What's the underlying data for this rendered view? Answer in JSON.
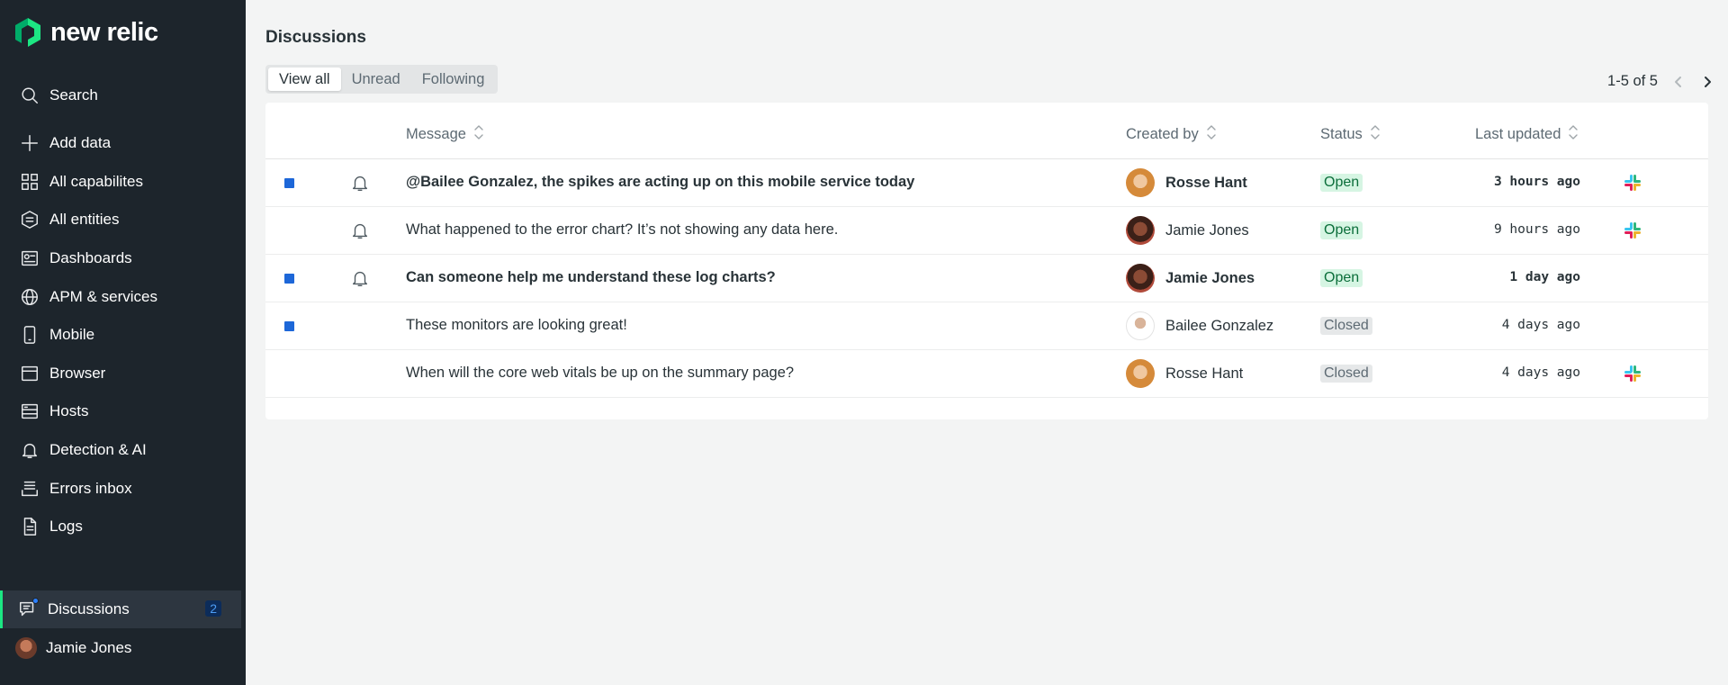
{
  "app": {
    "logo_text": "new relic",
    "brand_colors": {
      "primary": "#1ce783",
      "sidebar_bg": "#1d252c",
      "accent_blue": "#1d67d8"
    }
  },
  "sidebar": {
    "search_label": "Search",
    "items": [
      {
        "label": "Add data",
        "icon": "plus-icon"
      },
      {
        "label": "All capabilites",
        "icon": "grid-icon"
      },
      {
        "label": "All entities",
        "icon": "hexagon-icon"
      },
      {
        "label": "Dashboards",
        "icon": "dashboard-icon"
      },
      {
        "label": "APM & services",
        "icon": "globe-icon"
      },
      {
        "label": "Mobile",
        "icon": "mobile-icon"
      },
      {
        "label": "Browser",
        "icon": "browser-icon"
      },
      {
        "label": "Hosts",
        "icon": "server-icon"
      },
      {
        "label": "Detection & AI",
        "icon": "bell-icon"
      },
      {
        "label": "Errors inbox",
        "icon": "inbox-icon"
      },
      {
        "label": "Logs",
        "icon": "document-icon"
      }
    ],
    "discussions": {
      "label": "Discussions",
      "count": "2",
      "icon": "chat-icon"
    },
    "user": {
      "name": "Jamie Jones"
    }
  },
  "main": {
    "title": "Discussions",
    "tabs": [
      "View all",
      "Unread",
      "Following"
    ],
    "active_tab": "View all",
    "pagination": "1-5 of 5",
    "columns": {
      "message": "Message",
      "created_by": "Created by",
      "status": "Status",
      "last_updated": "Last updated"
    },
    "rows": [
      {
        "unread": true,
        "following": true,
        "message": "@Bailee Gonzalez, the spikes are acting up on this mobile service today",
        "creator": "Rosse Hant",
        "status": "Open",
        "updated": "3 hours ago",
        "slack": true
      },
      {
        "unread": false,
        "following": true,
        "message": "What happened to the error chart? It’s not showing any data here.",
        "creator": "Jamie Jones",
        "status": "Open",
        "updated": "9 hours ago",
        "slack": true
      },
      {
        "unread": true,
        "following": true,
        "message": "Can someone help me understand these log charts?",
        "creator": "Jamie Jones",
        "status": "Open",
        "updated": "1 day ago",
        "slack": false
      },
      {
        "unread": true,
        "following": false,
        "message": "These monitors are looking great!",
        "creator": "Bailee Gonzalez",
        "status": "Closed",
        "updated": "4 days ago",
        "slack": false
      },
      {
        "unread": false,
        "following": false,
        "message": "When will the core web vitals be up on the summary page?",
        "creator": "Rosse Hant",
        "status": "Closed",
        "updated": "4 days ago",
        "slack": true
      }
    ]
  }
}
